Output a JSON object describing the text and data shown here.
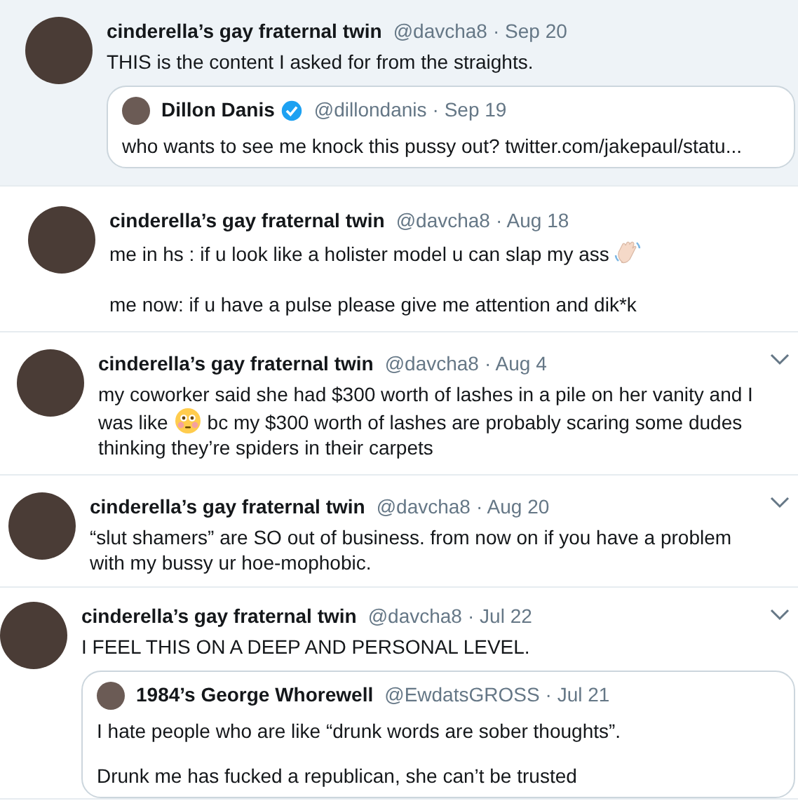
{
  "tweets": [
    {
      "name": "cinderella’s gay fraternal twin",
      "handle": "@davcha8",
      "date": "· Sep 20",
      "highlighted": true,
      "menu": false,
      "body": [
        [
          {
            "kind": "text",
            "text": "THIS is the content I asked for from the straights."
          }
        ]
      ],
      "quote": {
        "name": "Dillon Danis",
        "verified": true,
        "handle": "@dillondanis",
        "date": "· Sep 19",
        "body": [
          "who wants to see me knock this pussy out? twitter.com/jakepaul/statu..."
        ]
      }
    },
    {
      "name": "cinderella’s gay fraternal twin",
      "handle": "@davcha8",
      "date": "· Aug 18",
      "highlighted": false,
      "menu": false,
      "body": [
        [
          {
            "kind": "text",
            "text": "me in hs : if u look like a holister model u can slap my ass"
          },
          {
            "kind": "wave"
          }
        ],
        [
          {
            "kind": "text",
            "text": "me now: if u have a pulse please give me attention and dik*k"
          }
        ]
      ]
    },
    {
      "name": "cinderella’s gay fraternal twin",
      "handle": "@davcha8",
      "date": "· Aug 4",
      "highlighted": false,
      "menu": true,
      "body": [
        [
          {
            "kind": "text",
            "text": "my coworker said she had $300 worth of lashes in a pile on her vanity and I was like"
          },
          {
            "kind": "flushed"
          },
          {
            "kind": "text",
            "text": "bc my $300 worth of lashes are probably scaring some dudes thinking they’re spiders in their carpets"
          }
        ]
      ]
    },
    {
      "name": "cinderella’s gay fraternal twin",
      "handle": "@davcha8",
      "date": "· Aug 20",
      "highlighted": false,
      "menu": true,
      "body": [
        [
          {
            "kind": "text",
            "text": "“slut shamers” are SO out of business. from now on if you have a problem with my bussy ur hoe-mophobic."
          }
        ]
      ]
    },
    {
      "name": "cinderella’s gay fraternal twin",
      "handle": "@davcha8",
      "date": "· Jul 22",
      "highlighted": false,
      "menu": true,
      "body": [
        [
          {
            "kind": "text",
            "text": "I FEEL THIS ON A DEEP AND PERSONAL LEVEL."
          }
        ]
      ],
      "quote": {
        "name": "1984’s George Whorewell",
        "verified": false,
        "handle": "@EwdatsGROSS",
        "date": "· Jul 21",
        "body": [
          "I hate people who are like “drunk words are sober thoughts”.",
          "Drunk me has fucked a republican, she can’t be trusted"
        ]
      }
    }
  ]
}
